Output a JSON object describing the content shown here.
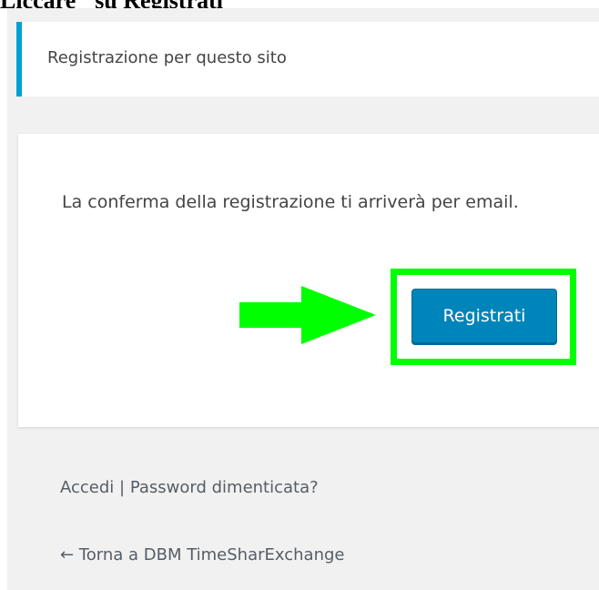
{
  "header_fragment": "Liccare \"su Registrati\"",
  "message": {
    "text": "Registrazione per questo sito"
  },
  "form": {
    "info_text": "La conferma della registrazione ti arriverà per email.",
    "register_button_label": "Registrati"
  },
  "nav": {
    "login_label": "Accedi",
    "separator": " | ",
    "lost_password_label": "Password dimenticata?",
    "back_label": "← Torna a DBM TimeSharExchange"
  },
  "colors": {
    "accent_blue": "#0085ba",
    "message_border": "#00a0d2",
    "highlight_green": "#00ff00",
    "background": "#f1f1f1"
  }
}
